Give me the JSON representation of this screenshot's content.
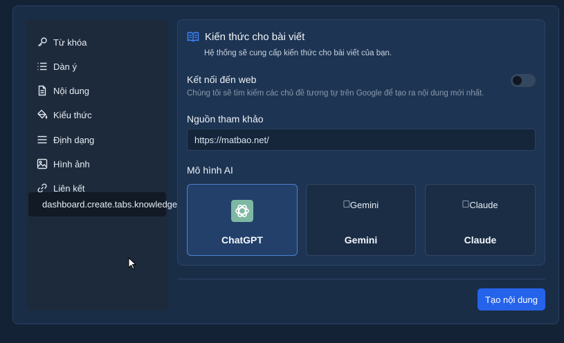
{
  "sidebar": {
    "items": [
      {
        "label": "Từ khóa",
        "icon": "key-icon"
      },
      {
        "label": "Dàn ý",
        "icon": "list-icon"
      },
      {
        "label": "Nội dung",
        "icon": "document-icon"
      },
      {
        "label": "Kiểu thức",
        "icon": "paint-bucket-icon"
      },
      {
        "label": "Định dạng",
        "icon": "menu-lines-icon"
      },
      {
        "label": "Hình ảnh",
        "icon": "image-icon"
      },
      {
        "label": "Liên kết",
        "icon": "link-icon"
      },
      {
        "label": "dashboard.create.tabs.knowledge",
        "active": true
      }
    ]
  },
  "knowledge": {
    "title": "Kiến thức cho bài viết",
    "description": "Hệ thống sẽ cung cấp kiến thức cho bài viết của bạn.",
    "icon": "book-open-icon"
  },
  "web": {
    "label": "Kết nối đến web",
    "hint": "Chúng tôi sẽ tìm kiếm các chủ đề tương tự trên Google để tạo ra nội dung mới nhất.",
    "enabled": false
  },
  "reference": {
    "label": "Nguồn tham khảo",
    "value": "https://matbao.net/"
  },
  "ai_model": {
    "label": "Mô hình AI",
    "options": [
      {
        "name": "ChatGPT",
        "selected": true,
        "logo_color": "#7eb8a4"
      },
      {
        "name": "Gemini",
        "alt": "Gemini",
        "selected": false
      },
      {
        "name": "Claude",
        "alt": "Claude",
        "selected": false
      }
    ]
  },
  "actions": {
    "generate_label": "Tạo nội dung"
  },
  "colors": {
    "accent": "#2563eb",
    "selected_border": "#4d82d0",
    "background": "#142236"
  }
}
